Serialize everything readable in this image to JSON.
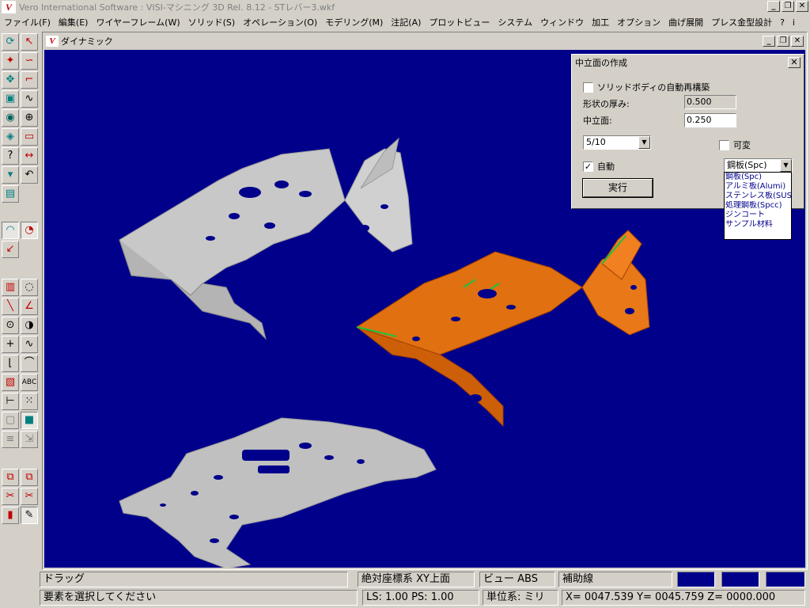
{
  "window": {
    "logo": "V",
    "title": "Vero International Software : VISI-マシニング 3D Rel. 8.12 - STレバー3.wkf",
    "controls": {
      "minimize": "_",
      "restore": "❐",
      "close": "✕"
    }
  },
  "menu": [
    "ファイル(F)",
    "編集(E)",
    "ワイヤーフレーム(W)",
    "ソリッド(S)",
    "オペレーション(O)",
    "モデリング(M)",
    "注記(A)",
    "プロットビュー",
    "システム",
    "ウィンドウ",
    "加工",
    "オプション",
    "曲げ展開",
    "プレス金型設計",
    "?",
    "i"
  ],
  "view_window": {
    "title": "ダイナミック",
    "background": "#00008b"
  },
  "dialog": {
    "title": "中立面の作成",
    "close": "✕",
    "solid_rebuild_label": "ソリッドボディの自動再構築",
    "solid_rebuild_checked": false,
    "thickness_label": "形状の厚み:",
    "thickness_value": "0.500",
    "neutral_label": "中立面:",
    "neutral_value": "0.250",
    "ratio_value": "5/10",
    "variable_label": "可変",
    "variable_checked": false,
    "auto_label": "自動",
    "auto_checked": true,
    "auto_check_mark": "✓",
    "material_value": "鋼板(Spc)",
    "execute_label": "実行",
    "material_options": [
      "鋼板(Spc)",
      "アルミ板(Alumi)",
      "ステンレス板(SUS)",
      "処理鋼板(Spcc)",
      "ジンコート",
      "サンプル材料"
    ]
  },
  "status": {
    "pane1": "ドラッグ",
    "pane2": "絶対座標系  XY上面",
    "pane3": "ビュー ABS",
    "pane4": "補助線",
    "pane5": "要素を選択してください",
    "pane6": "LS: 1.00  PS: 1.00",
    "pane7": "単位系: ミリ",
    "pane8": "X= 0047.539 Y= 0045.759 Z= 0000.000"
  },
  "colors": {
    "part_gray": "#c8c8c8",
    "part_orange": "#e07010",
    "edge_green": "#20c040"
  }
}
